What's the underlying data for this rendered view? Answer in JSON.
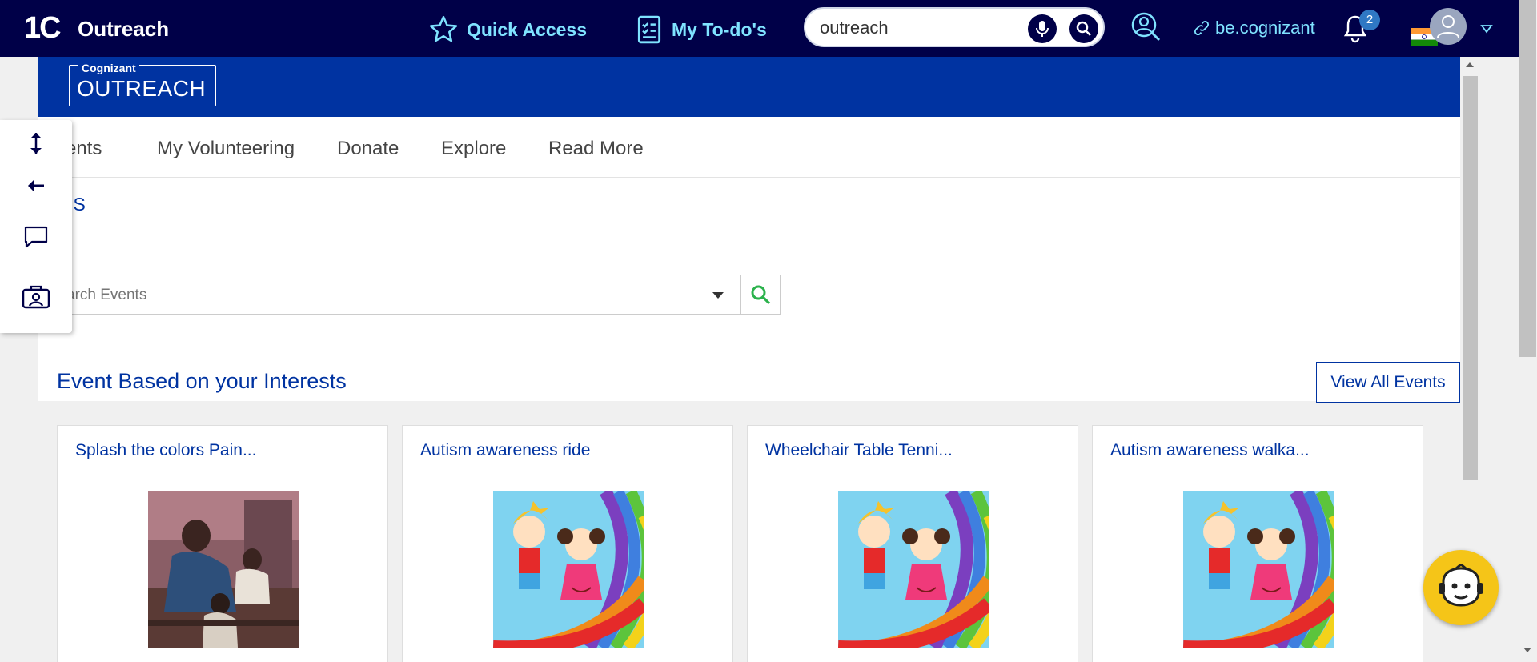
{
  "topbar": {
    "logo": "1C",
    "app_name": "Outreach",
    "quick_access": "Quick Access",
    "todos": "My To-do's",
    "search_value": "outreach",
    "link_text": "be.cognizant",
    "notification_count": "2"
  },
  "brand": {
    "small": "Cognizant",
    "big": "OUTREACH"
  },
  "tabs": [
    "vents",
    "My Volunteering",
    "Donate",
    "Explore",
    "Read More"
  ],
  "user_name": "i S",
  "event_search": {
    "placeholder": "arch Events"
  },
  "section": {
    "title": "Event Based on your Interests",
    "view_all": "View All Events"
  },
  "cards": [
    {
      "title": "Splash the colors Pain...",
      "image": "classroom-photo"
    },
    {
      "title": "Autism awareness ride",
      "image": "kids-rainbow"
    },
    {
      "title": "Wheelchair Table Tenni...",
      "image": "kids-rainbow"
    },
    {
      "title": "Autism awareness walka...",
      "image": "kids-rainbow"
    }
  ],
  "colors": {
    "topbar": "#000048",
    "accent": "#7fe3ff",
    "brand_blue": "#0033a1",
    "search_green": "#2bb24c",
    "bot_yellow": "#f5c518"
  }
}
